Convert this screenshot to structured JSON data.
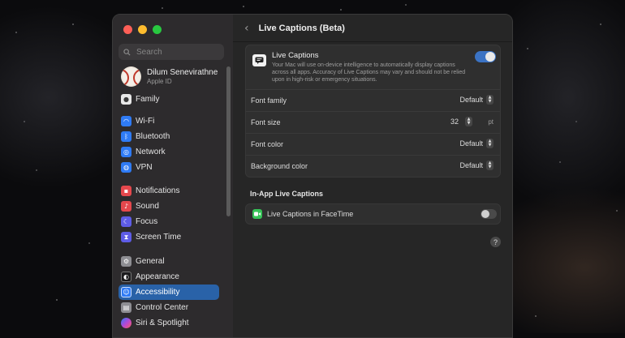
{
  "sidebar": {
    "search_placeholder": "Search",
    "profile": {
      "name": "Dilum Senevirathne",
      "sub": "Apple ID"
    },
    "items": [
      {
        "label": "Family",
        "icon": "family-icon",
        "color": "#e8e8e8"
      },
      {
        "label": "Wi-Fi",
        "icon": "wifi-icon",
        "color": "#2f7bf5"
      },
      {
        "label": "Bluetooth",
        "icon": "bluetooth-icon",
        "color": "#2f7bf5"
      },
      {
        "label": "Network",
        "icon": "network-icon",
        "color": "#2f7bf5"
      },
      {
        "label": "VPN",
        "icon": "vpn-icon",
        "color": "#2f7bf5"
      },
      {
        "label": "Notifications",
        "icon": "notifications-icon",
        "color": "#e5484d"
      },
      {
        "label": "Sound",
        "icon": "sound-icon",
        "color": "#e5484d"
      },
      {
        "label": "Focus",
        "icon": "focus-icon",
        "color": "#5e5ce6"
      },
      {
        "label": "Screen Time",
        "icon": "screen-time-icon",
        "color": "#5e5ce6"
      },
      {
        "label": "General",
        "icon": "general-icon",
        "color": "#8e8e93"
      },
      {
        "label": "Appearance",
        "icon": "appearance-icon",
        "color": "#1c1c1e"
      },
      {
        "label": "Accessibility",
        "icon": "accessibility-icon",
        "color": "#2f7bf5"
      },
      {
        "label": "Control Center",
        "icon": "control-center-icon",
        "color": "#8e8e93"
      },
      {
        "label": "Siri & Spotlight",
        "icon": "siri-icon",
        "color": "#6e4bd8"
      }
    ],
    "active_item": "Accessibility"
  },
  "main": {
    "title": "Live Captions (Beta)",
    "live_captions": {
      "title": "Live Captions",
      "description": "Your Mac will use on-device intelligence to automatically display captions across all apps. Accuracy of Live Captions may vary and should not be relied upon in high-risk or emergency situations.",
      "enabled": true
    },
    "settings": {
      "font_family": {
        "label": "Font family",
        "value": "Default"
      },
      "font_size": {
        "label": "Font size",
        "value": "32",
        "unit": "pt"
      },
      "font_color": {
        "label": "Font color",
        "value": "Default"
      },
      "background_color": {
        "label": "Background color",
        "value": "Default"
      }
    },
    "in_app_section_title": "In-App Live Captions",
    "facetime": {
      "label": "Live Captions in FaceTime",
      "enabled": false
    },
    "help_label": "?"
  },
  "colors": {
    "accent": "#3b73c4",
    "sidebar_active": "#2962a8"
  }
}
